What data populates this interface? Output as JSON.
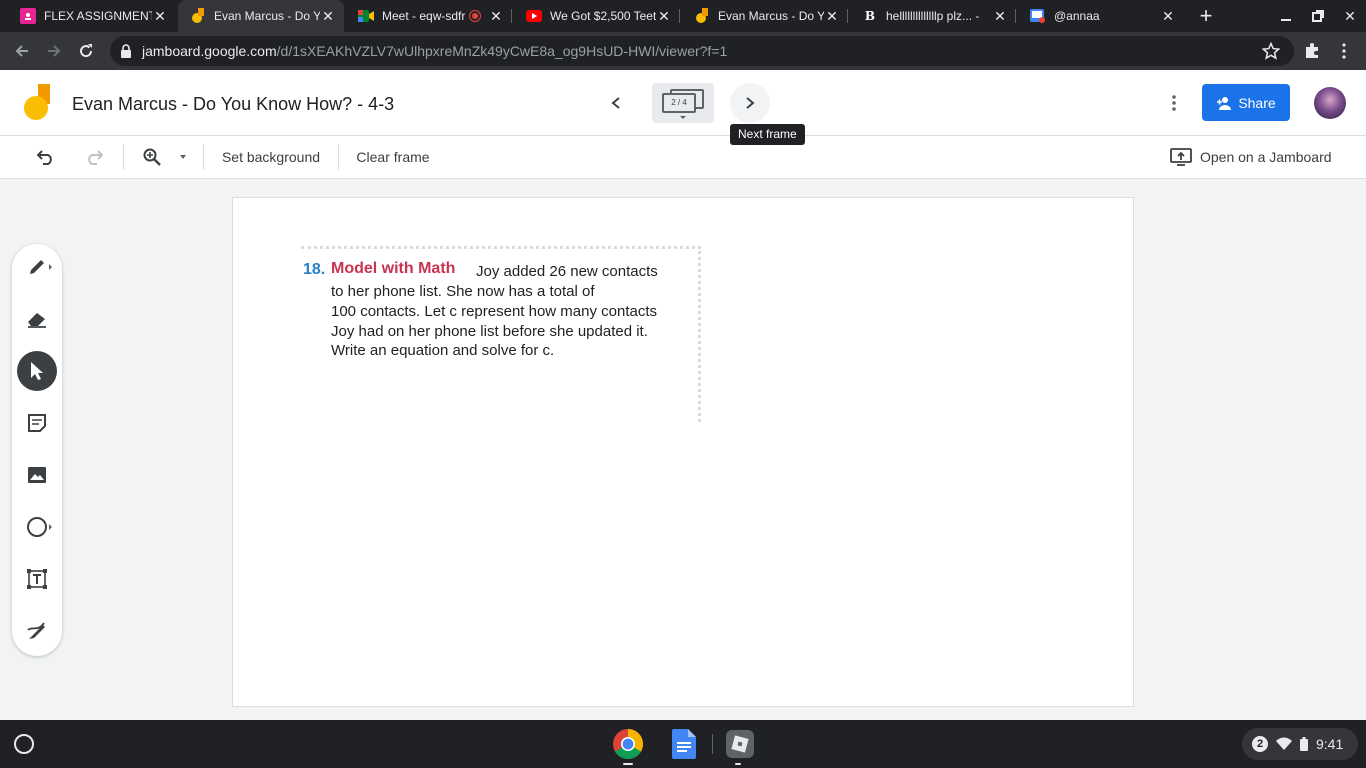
{
  "browser": {
    "tabs": [
      {
        "title": "FLEX ASSIGNMENT",
        "favicon": "classroom-icon",
        "favicon_color": "#e52592"
      },
      {
        "title": "Evan Marcus - Do Y",
        "favicon": "jamboard-icon",
        "favicon_color": "#fbbc04"
      },
      {
        "title": "Meet - eqw-sdfr",
        "favicon": "meet-icon",
        "favicon_color": "#00832d"
      },
      {
        "title": "We Got $2,500 Teet",
        "favicon": "youtube-icon",
        "favicon_color": "#ff0000"
      },
      {
        "title": "Evan Marcus - Do Y",
        "favicon": "jamboard-icon",
        "favicon_color": "#fbbc04"
      },
      {
        "title": "hellllllllllllllp plz... -",
        "favicon": "brainly-icon",
        "favicon_color": "#ffffff"
      },
      {
        "title": "@annaa",
        "favicon": "image-search-icon",
        "favicon_color": "#4285f4"
      }
    ],
    "url_host": "jamboard.google.com",
    "url_path": "/d/1sXEAKhVZLV7wUlhpxreMnZk49yCwE8a_og9HsUD-HWI/viewer?f=1"
  },
  "jamboard": {
    "title": "Evan Marcus - Do You Know How? - 4-3",
    "frame_indicator": "2 / 4",
    "tooltip": "Next frame",
    "share_label": "Share",
    "toolbar": {
      "set_background": "Set background",
      "clear_frame": "Clear frame",
      "open_on_jamboard": "Open on a Jamboard"
    },
    "problem": {
      "number": "18.",
      "heading": "Model with Math",
      "lines": [
        "Joy added 26 new contacts",
        "to her phone list. She now has a total of",
        "100 contacts. Let c represent how many contacts",
        "Joy had on her phone list before she updated it.",
        "Write an equation and solve for c."
      ]
    }
  },
  "shelf": {
    "notification_count": "2",
    "time": "9:41"
  },
  "colors": {
    "accent": "#1a73e8",
    "problem_number": "#2a7fc6",
    "problem_heading": "#c8334f"
  }
}
